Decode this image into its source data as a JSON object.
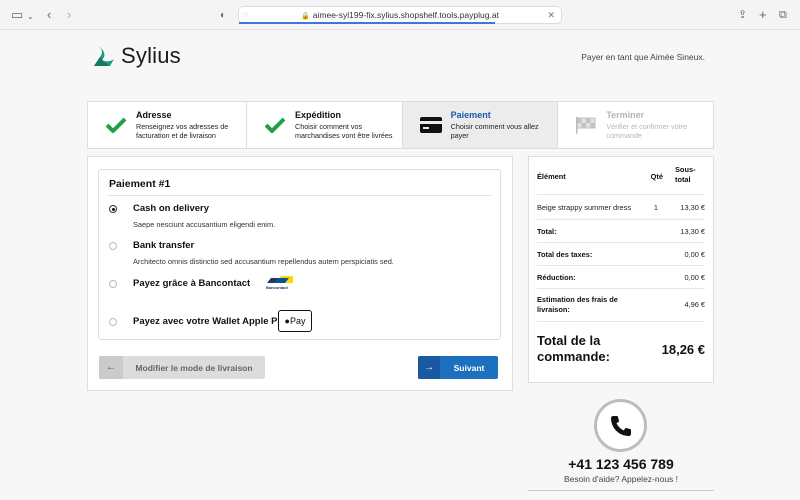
{
  "browser": {
    "url": "aimee-syl199-fix.sylius.shopshelf.tools.payplug.at"
  },
  "header": {
    "logo_text": "Sylius",
    "pay_as": "Payer en tant que Aimée Sineux."
  },
  "steps": [
    {
      "title": "Adresse",
      "desc": "Renseignez vos adresses de facturation et de livraison",
      "state": "done"
    },
    {
      "title": "Expédition",
      "desc": "Choisir comment vos marchandises vont être livrées",
      "state": "done"
    },
    {
      "title": "Paiement",
      "desc": "Choisir comment vous allez payer",
      "state": "active"
    },
    {
      "title": "Terminer",
      "desc": "Vérifier et confirmer votre commande",
      "state": "disabled"
    }
  ],
  "payment": {
    "title": "Paiement #1",
    "options": [
      {
        "label": "Cash on delivery",
        "desc": "Saepe nesciunt accusantium eligendi enim.",
        "checked": true
      },
      {
        "label": "Bank transfer",
        "desc": "Architecto omnis distinctio sed accusantium repellendus autem perspiciatis sed.",
        "checked": false
      },
      {
        "label": "Payez grâce à Bancontact",
        "desc": "",
        "checked": false,
        "logo_text": "Bancontact"
      },
      {
        "label": "Payez avec votre Wallet Apple Pay",
        "desc": "",
        "checked": false,
        "badge": "Pay"
      }
    ],
    "back_label": "Modifier le mode de livraison",
    "next_label": "Suivant"
  },
  "summary": {
    "headers": {
      "item": "Élément",
      "qty": "Qté",
      "subtotal_line1": "Sous-",
      "subtotal_line2": "total"
    },
    "item": {
      "name": "Beige strappy summer dress",
      "qty": "1",
      "subtotal": "13,30 €"
    },
    "total_label": "Total:",
    "total_value": "13,30 €",
    "taxes_label": "Total des taxes:",
    "taxes_value": "0,00 €",
    "discount_label": "Réduction:",
    "discount_value": "0,00 €",
    "shipping_label_1": "Estimation des frais de",
    "shipping_label_2": "livraison:",
    "shipping_value": "4,96 €",
    "order_total_label_1": "Total de la",
    "order_total_label_2": "commande:",
    "order_total_value": "18,26 €"
  },
  "help": {
    "phone": "+41 123 456 789",
    "text": "Besoin d'aide? Appelez-nous !"
  },
  "colors": {
    "accent": "#1d6fc0",
    "check": "#21a04a",
    "brand": "#1f9a7a"
  }
}
